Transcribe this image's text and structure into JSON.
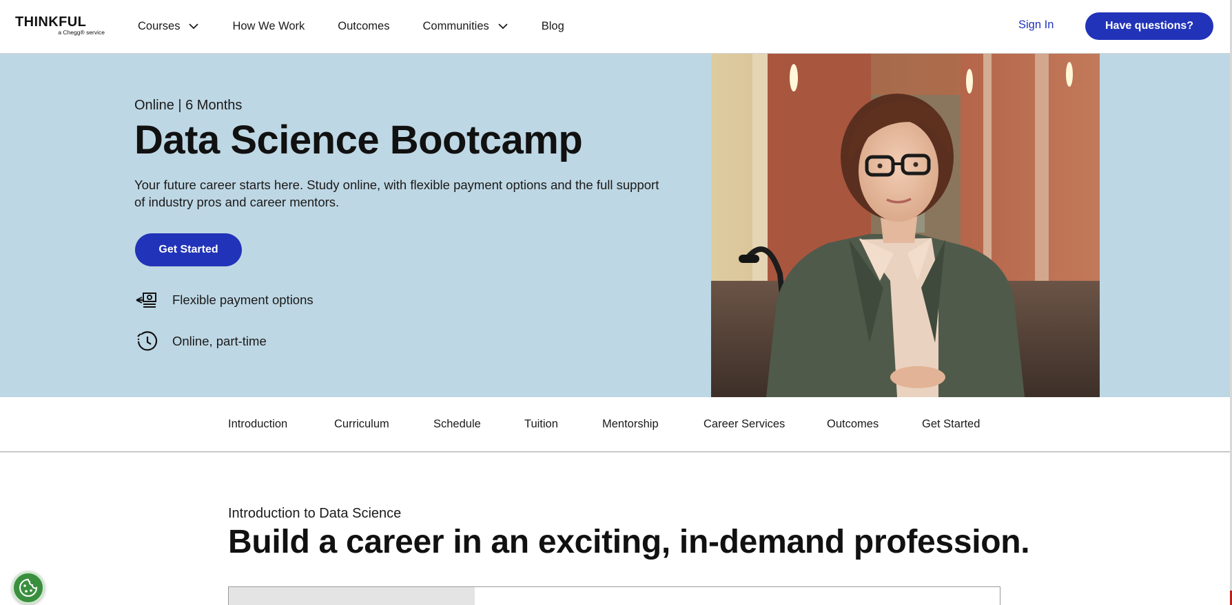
{
  "header": {
    "logo_text": "THINKFUL",
    "logo_sub": "a Chegg® service",
    "nav": [
      {
        "label": "Courses",
        "dropdown": true
      },
      {
        "label": "How We Work",
        "dropdown": false
      },
      {
        "label": "Outcomes",
        "dropdown": false
      },
      {
        "label": "Communities",
        "dropdown": true
      },
      {
        "label": "Blog",
        "dropdown": false
      }
    ],
    "sign_in": "Sign In",
    "cta": "Have questions?"
  },
  "hero": {
    "eyebrow": "Online | 6 Months",
    "title": "Data Science Bootcamp",
    "description": "Your future career starts here. Study online, with flexible payment options and the full support of industry pros and career mentors.",
    "cta": "Get Started",
    "features": [
      {
        "icon": "payment-icon",
        "label": "Flexible payment options"
      },
      {
        "icon": "clock-icon",
        "label": "Online, part-time"
      }
    ]
  },
  "section_nav": [
    "Introduction",
    "Curriculum",
    "Schedule",
    "Tuition",
    "Mentorship",
    "Career Services",
    "Outcomes",
    "Get Started"
  ],
  "intro": {
    "eyebrow": "Introduction to Data Science",
    "title": "Build a career in an exciting, in-demand profession."
  },
  "colors": {
    "brand_blue": "#2133b8",
    "hero_bg": "#bed7e4",
    "cookie_green": "#3a8f3e"
  }
}
